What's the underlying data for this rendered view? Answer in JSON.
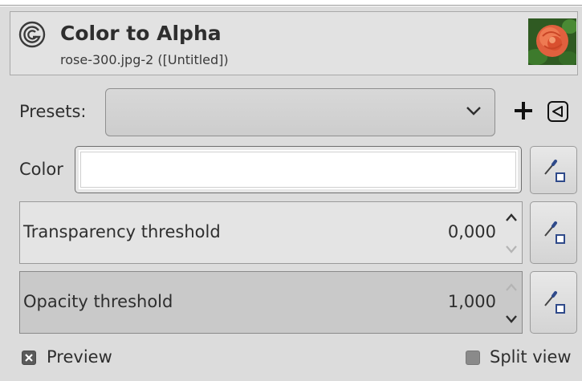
{
  "header": {
    "title": "Color to Alpha",
    "subtitle": "rose-300.jpg-2 ([Untitled])"
  },
  "presets": {
    "label": "Presets:",
    "selected": ""
  },
  "color": {
    "label": "Color",
    "value_hex": "#ffffff"
  },
  "transparency_threshold": {
    "label": "Transparency threshold",
    "value": "0,000"
  },
  "opacity_threshold": {
    "label": "Opacity threshold",
    "value": "1,000"
  },
  "options": {
    "preview_label": "Preview",
    "preview_checked": true,
    "split_view_label": "Split view",
    "split_view_checked": false
  },
  "icons": {
    "gimp": "gimp-logo-icon",
    "dropdown": "chevron-down-icon",
    "add": "plus-icon",
    "menu": "triangle-left-menu-icon",
    "picker": "eyedropper-icon"
  },
  "colors": {
    "background": "#dcdcdc",
    "field": "#ffffff",
    "text": "#2e2e2e"
  }
}
